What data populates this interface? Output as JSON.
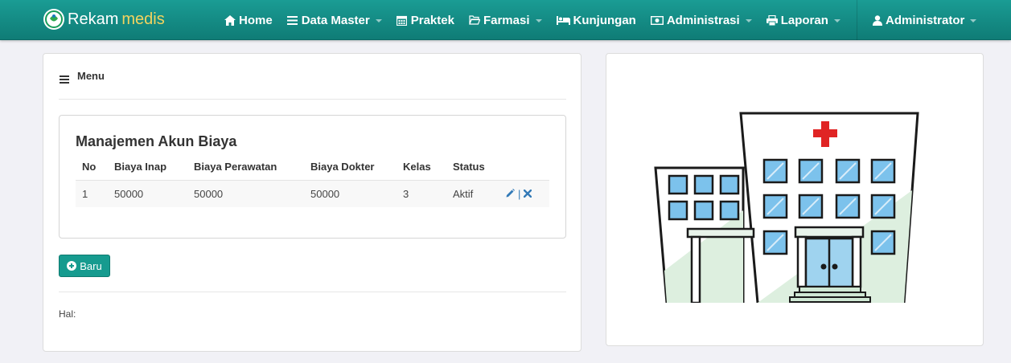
{
  "brand": {
    "name_part1": "Rekam",
    "name_part2": "medis"
  },
  "nav": [
    {
      "label": "Home",
      "icon": "home-icon"
    },
    {
      "label": "Data Master",
      "icon": "list-icon",
      "dropdown": true
    },
    {
      "label": "Praktek",
      "icon": "calendar-icon"
    },
    {
      "label": "Farmasi",
      "icon": "folder-icon",
      "dropdown": true
    },
    {
      "label": "Kunjungan",
      "icon": "bed-icon"
    },
    {
      "label": "Administrasi",
      "icon": "money-icon",
      "dropdown": true
    },
    {
      "label": "Laporan",
      "icon": "print-icon",
      "dropdown": true
    }
  ],
  "user": {
    "label": "Administrator",
    "icon": "user-icon"
  },
  "menu": {
    "title": "Menu"
  },
  "card": {
    "title": "Manajemen Akun Biaya",
    "columns": [
      "No",
      "Biaya Inap",
      "Biaya Perawatan",
      "Biaya Dokter",
      "Kelas",
      "Status"
    ],
    "rows": [
      {
        "no": "1",
        "inap": "50000",
        "perawatan": "50000",
        "dokter": "50000",
        "kelas": "3",
        "status": "Aktif"
      }
    ],
    "action_separator": "|"
  },
  "buttons": {
    "new_label": "Baru"
  },
  "footer": {
    "page_label": "Hal:"
  },
  "colors": {
    "navbar": "#139089",
    "accent": "#169b8f",
    "brand_highlight": "#f4d35e",
    "action_icon": "#337ab7"
  }
}
